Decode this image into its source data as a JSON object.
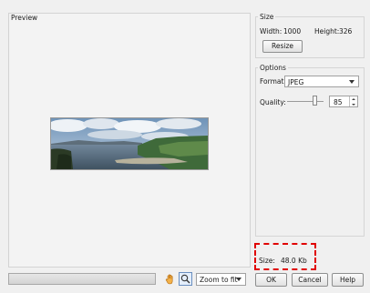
{
  "preview": {
    "title": "Preview"
  },
  "size_group": {
    "title": "Size",
    "width_label": "Width:",
    "width_value": "1000",
    "height_label": "Height:",
    "height_value": "326",
    "resize_label": "Resize"
  },
  "options_group": {
    "title": "Options",
    "format_label": "Format:",
    "format_value": "JPEG",
    "quality_label": "Quality:",
    "quality_value": "85"
  },
  "file_size": {
    "label": "Size:",
    "value": "48.0 Kb"
  },
  "bottom": {
    "zoom_value": "Zoom to fit",
    "ok_label": "OK",
    "cancel_label": "Cancel",
    "help_label": "Help"
  },
  "colors": {
    "highlight": "#e00000",
    "hand_icon": "#d98b1a"
  },
  "icons": [
    "hand-tool-icon",
    "zoom-tool-icon",
    "chevron-down-icon"
  ]
}
